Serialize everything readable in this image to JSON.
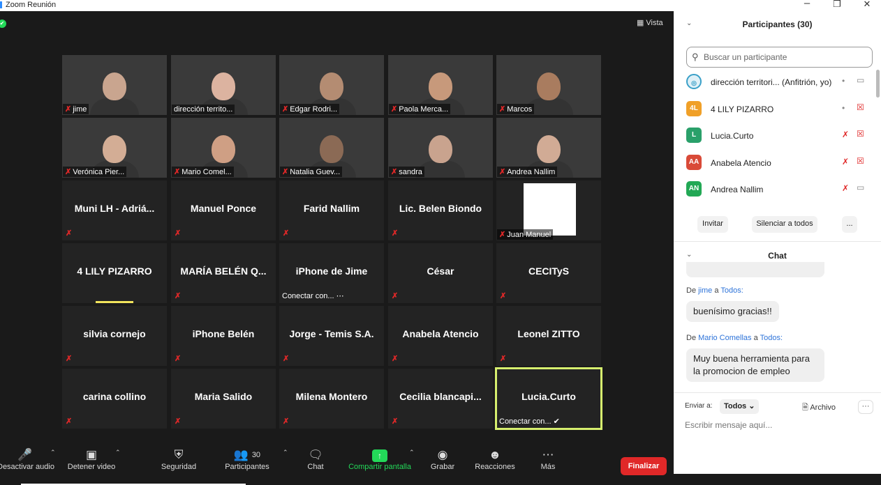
{
  "window": {
    "title": "Zoom Reunión",
    "minimize": "–",
    "restore": "❐",
    "close": "✕"
  },
  "meeting": {
    "view_label": "Vista",
    "view_icon": "grid-icon",
    "security_indicator": "✔"
  },
  "tiles": [
    {
      "name": "jime",
      "video": true,
      "muted": true,
      "skin": "#c9a58f"
    },
    {
      "name": "dirección territo...",
      "video": true,
      "muted": false,
      "skin": "#dcb3a0"
    },
    {
      "name": "Edgar Rodri...",
      "video": true,
      "muted": true,
      "skin": "#b48c72"
    },
    {
      "name": "Paola Merca...",
      "video": true,
      "muted": true,
      "skin": "#c7997b"
    },
    {
      "name": "Marcos",
      "video": true,
      "muted": true,
      "skin": "#a97c5f"
    },
    {
      "name": "Verónica Pier...",
      "video": true,
      "muted": true,
      "skin": "#d3ad95"
    },
    {
      "name": "Mario Comel...",
      "video": true,
      "muted": true,
      "skin": "#cf9f84"
    },
    {
      "name": "Natalia Guev...",
      "video": true,
      "muted": true,
      "skin": "#8b6a55"
    },
    {
      "name": "sandra",
      "video": true,
      "muted": true,
      "skin": "#c9a38e"
    },
    {
      "name": "Andrea Nallim",
      "video": true,
      "muted": true,
      "skin": "#d1ab95"
    },
    {
      "name": "Muni LH - Adriá...",
      "video": false,
      "muted": true
    },
    {
      "name": "Manuel Ponce",
      "video": false,
      "muted": true
    },
    {
      "name": "Farid Nallim",
      "video": false,
      "muted": true
    },
    {
      "name": "Lic. Belen Biondo",
      "video": false,
      "muted": true
    },
    {
      "name": "Juan Manuel",
      "video": true,
      "muted": true,
      "white": true
    },
    {
      "name": "4 LILY PIZARRO",
      "video": false,
      "muted": false,
      "speaking": true
    },
    {
      "name": "MARÍA BELÉN Q...",
      "video": false,
      "muted": true
    },
    {
      "name": "iPhone de Jime",
      "video": false,
      "muted": false,
      "connect": "Conectar con... ⋯"
    },
    {
      "name": "César",
      "video": false,
      "muted": true
    },
    {
      "name": "CECITyS",
      "video": false,
      "muted": true
    },
    {
      "name": "silvia cornejo",
      "video": false,
      "muted": true
    },
    {
      "name": "iPhone Belén",
      "video": false,
      "muted": true
    },
    {
      "name": "Jorge - Temis S.A.",
      "video": false,
      "muted": true
    },
    {
      "name": "Anabela Atencio",
      "video": false,
      "muted": true
    },
    {
      "name": "Leonel ZITTO",
      "video": false,
      "muted": true
    },
    {
      "name": "carina collino",
      "video": false,
      "muted": true
    },
    {
      "name": "Maria Salido",
      "video": false,
      "muted": true
    },
    {
      "name": "Milena Montero",
      "video": false,
      "muted": true
    },
    {
      "name": "Cecilia  blancapi...",
      "video": false,
      "muted": true
    },
    {
      "name": "Lucia.Curto",
      "video": false,
      "muted": false,
      "active": true,
      "connect": "Conectar con... ✔"
    }
  ],
  "toolbar": {
    "audio": "Desactivar audio",
    "video": "Detener video",
    "security": "Seguridad",
    "participants": "Participantes",
    "participants_count": "30",
    "chat": "Chat",
    "share": "Compartir pantalla",
    "record": "Grabar",
    "reactions": "Reacciones",
    "more": "Más",
    "end": "Finalizar"
  },
  "participants_panel": {
    "title": "Participantes (30)",
    "search_placeholder": "Buscar un participante",
    "rows": [
      {
        "initials": "",
        "name": "dirección territori...",
        "tag": "(Anfitrión, yo)",
        "color": "#3aa0c8",
        "mic_off": false,
        "cam_off": false,
        "host": true
      },
      {
        "initials": "4L",
        "name": "4 LILY PIZARRO",
        "tag": "",
        "color": "#f0a028",
        "mic_off": false,
        "cam_off": true,
        "host": false
      },
      {
        "initials": "L",
        "name": "Lucia.Curto",
        "tag": "",
        "color": "#2aa06a",
        "mic_off": true,
        "cam_off": true,
        "host": false
      },
      {
        "initials": "AA",
        "name": "Anabela Atencio",
        "tag": "",
        "color": "#d94a38",
        "mic_off": true,
        "cam_off": true,
        "host": false
      },
      {
        "initials": "AN",
        "name": "Andrea Nallim",
        "tag": "",
        "color": "#22a855",
        "mic_off": true,
        "cam_off": false,
        "host": false
      }
    ],
    "invite": "Invitar",
    "mute_all": "Silenciar a todos",
    "more": "..."
  },
  "chat": {
    "title": "Chat",
    "messages": [
      {
        "prefix": "De",
        "from": "jime",
        "to_word": "a",
        "to": "Todos:",
        "text": "buenísimo gracias!!"
      },
      {
        "prefix": "De",
        "from": "Mario Comellas",
        "to_word": "a",
        "to": "Todos:",
        "text": "Muy buena herramienta para la promocion de empleo"
      }
    ],
    "send_to_label": "Enviar a:",
    "send_to_value": "Todos ⌄",
    "file_label": "Archivo",
    "more": "···",
    "input_placeholder": "Escribir mensaje aquí..."
  }
}
